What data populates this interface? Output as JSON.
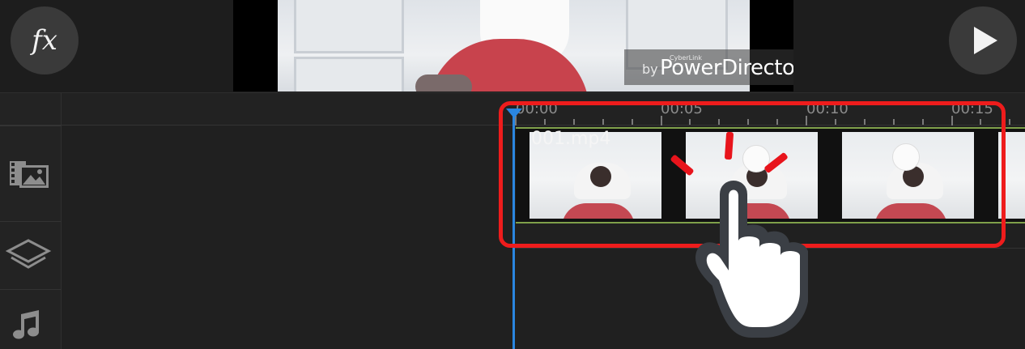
{
  "toolbar": {
    "fx_label": "fx",
    "play_icon": "play-icon"
  },
  "preview": {
    "watermark_by": "by",
    "watermark_brand": "CyberLink",
    "watermark_product": "PowerDirector"
  },
  "timeline": {
    "ticks": [
      "00:00",
      "00:05",
      "00:10",
      "00:15"
    ],
    "clip": {
      "name": "001.mp4"
    },
    "tracks": [
      {
        "icon": "video-image-track-icon"
      },
      {
        "icon": "layers-track-icon"
      },
      {
        "icon": "music-track-icon"
      }
    ]
  },
  "colors": {
    "highlight": "#ee1c1c",
    "playhead": "#2a86e0",
    "clip_border": "#7fa04a"
  }
}
